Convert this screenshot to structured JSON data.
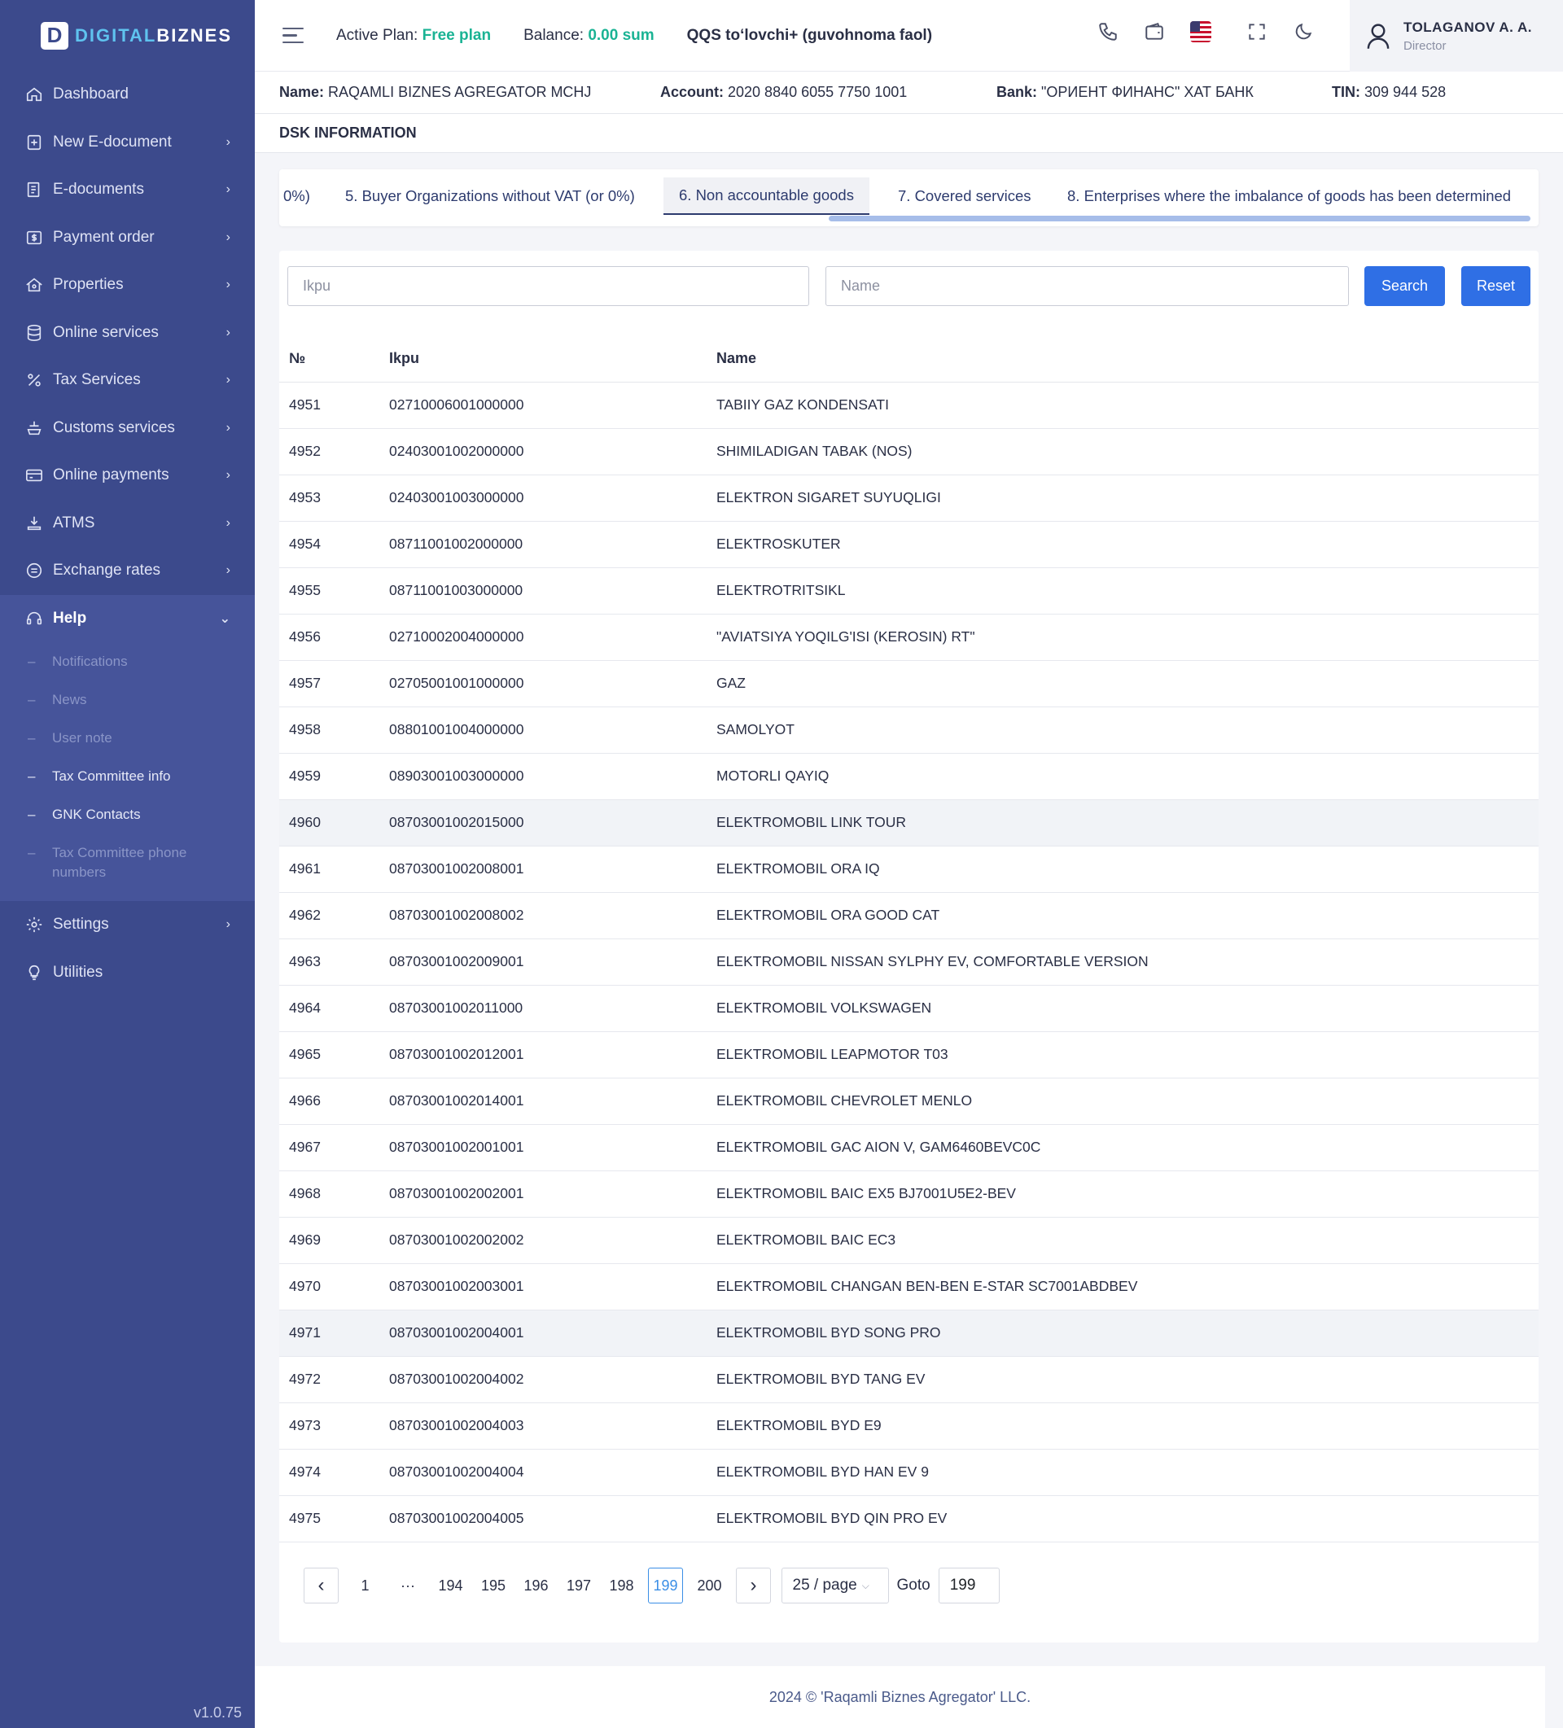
{
  "app": {
    "logo_letter": "D",
    "logo_part1": "DIGITAL",
    "logo_part2": "BIZNES",
    "version": "v1.0.75"
  },
  "sidebar": {
    "items": [
      {
        "label": "Dashboard",
        "icon": "home-icon"
      },
      {
        "label": "New E-document",
        "icon": "file-plus-icon"
      },
      {
        "label": "E-documents",
        "icon": "document-icon"
      },
      {
        "label": "Payment order",
        "icon": "dollar-icon"
      },
      {
        "label": "Properties",
        "icon": "house-icon"
      },
      {
        "label": "Online services",
        "icon": "database-icon"
      },
      {
        "label": "Tax Services",
        "icon": "percent-icon"
      },
      {
        "label": "Customs services",
        "icon": "customs-icon"
      },
      {
        "label": "Online payments",
        "icon": "card-icon"
      },
      {
        "label": "ATMS",
        "icon": "atm-icon"
      },
      {
        "label": "Exchange rates",
        "icon": "exchange-icon"
      },
      {
        "label": "Help",
        "icon": "headset-icon"
      },
      {
        "label": "Settings",
        "icon": "gear-icon"
      },
      {
        "label": "Utilities",
        "icon": "bulb-icon"
      }
    ],
    "help_sub": [
      {
        "label": "Notifications"
      },
      {
        "label": "News"
      },
      {
        "label": "User note"
      },
      {
        "label": "Tax Committee info"
      },
      {
        "label": "GNK Contacts"
      },
      {
        "label": "Tax Committee phone numbers"
      }
    ]
  },
  "topbar": {
    "plan_label": "Active Plan:",
    "plan_value": "Free plan",
    "balance_label": "Balance:",
    "balance_value": "0.00 sum",
    "qqs": "QQS toʻlovchi+ (guvohnoma faol)",
    "user_name": "TOLAGANOV A. A.",
    "user_role": "Director"
  },
  "company": {
    "name_label": "Name:",
    "name_value": "RAQAMLI BIZNES AGREGATOR MCHJ",
    "account_label": "Account:",
    "account_value": "2020 8840 6055 7750 1001",
    "bank_label": "Bank:",
    "bank_value": "\"ОРИЕНТ ФИНАНС\" ХАТ БАНК",
    "tin_label": "TIN:",
    "tin_value": "309 944 528"
  },
  "page": {
    "title": "DSK INFORMATION",
    "tabs": [
      {
        "label": "0%)"
      },
      {
        "label": "5. Buyer Organizations without VAT (or 0%)"
      },
      {
        "label": "6. Non accountable goods"
      },
      {
        "label": "7. Covered services"
      },
      {
        "label": "8. Enterprises where the imbalance of goods has been determined"
      }
    ]
  },
  "filters": {
    "ikpu_placeholder": "Ikpu",
    "name_placeholder": "Name",
    "search_label": "Search",
    "reset_label": "Reset"
  },
  "table": {
    "headers": [
      "№",
      "Ikpu",
      "Name"
    ],
    "rows": [
      {
        "num": "4951",
        "ikpu": "02710006001000000",
        "name": "TABIIY GAZ KONDENSATI"
      },
      {
        "num": "4952",
        "ikpu": "02403001002000000",
        "name": "SHIMILADIGAN TABAK (NOS)"
      },
      {
        "num": "4953",
        "ikpu": "02403001003000000",
        "name": "ELEKTRON SIGARET SUYUQLIGI"
      },
      {
        "num": "4954",
        "ikpu": "08711001002000000",
        "name": "ELEKTROSKUTER"
      },
      {
        "num": "4955",
        "ikpu": "08711001003000000",
        "name": "ELEKTROTRITSIKL"
      },
      {
        "num": "4956",
        "ikpu": "02710002004000000",
        "name": "\"AVIATSIYA YOQILG'ISI (KEROSIN) RT\""
      },
      {
        "num": "4957",
        "ikpu": "02705001001000000",
        "name": "GAZ"
      },
      {
        "num": "4958",
        "ikpu": "08801001004000000",
        "name": "SAMOLYOT"
      },
      {
        "num": "4959",
        "ikpu": "08903001003000000",
        "name": "MOTORLI QAYIQ"
      },
      {
        "num": "4960",
        "ikpu": "08703001002015000",
        "name": "ELEKTROMOBIL LINK TOUR"
      },
      {
        "num": "4961",
        "ikpu": "08703001002008001",
        "name": "ELEKTROMOBIL ORA IQ"
      },
      {
        "num": "4962",
        "ikpu": "08703001002008002",
        "name": "ELEKTROMOBIL ORA GOOD CAT"
      },
      {
        "num": "4963",
        "ikpu": "08703001002009001",
        "name": "ELEKTROMOBIL NISSAN SYLPHY EV, COMFORTABLE VERSION"
      },
      {
        "num": "4964",
        "ikpu": "08703001002011000",
        "name": "ELEKTROMOBIL VOLKSWAGEN"
      },
      {
        "num": "4965",
        "ikpu": "08703001002012001",
        "name": "ELEKTROMOBIL LEAPMOTOR T03"
      },
      {
        "num": "4966",
        "ikpu": "08703001002014001",
        "name": "ELEKTROMOBIL CHEVROLET MENLO"
      },
      {
        "num": "4967",
        "ikpu": "08703001002001001",
        "name": "ELEKTROMOBIL GAC AION V, GAM6460BEVC0C"
      },
      {
        "num": "4968",
        "ikpu": "08703001002002001",
        "name": "ELEKTROMOBIL BAIC EX5 BJ7001U5E2-BEV"
      },
      {
        "num": "4969",
        "ikpu": "08703001002002002",
        "name": "ELEKTROMOBIL BAIC EC3"
      },
      {
        "num": "4970",
        "ikpu": "08703001002003001",
        "name": "ELEKTROMOBIL CHANGAN BEN-BEN E-STAR SC7001ABDBEV"
      },
      {
        "num": "4971",
        "ikpu": "08703001002004001",
        "name": "ELEKTROMOBIL BYD SONG PRO"
      },
      {
        "num": "4972",
        "ikpu": "08703001002004002",
        "name": "ELEKTROMOBIL BYD TANG EV"
      },
      {
        "num": "4973",
        "ikpu": "08703001002004003",
        "name": "ELEKTROMOBIL BYD E9"
      },
      {
        "num": "4974",
        "ikpu": "08703001002004004",
        "name": "ELEKTROMOBIL BYD HAN EV 9"
      },
      {
        "num": "4975",
        "ikpu": "08703001002004005",
        "name": "ELEKTROMOBIL BYD QIN PRO EV"
      }
    ]
  },
  "pagination": {
    "pages": [
      "1",
      "···",
      "194",
      "195",
      "196",
      "197",
      "198",
      "199",
      "200"
    ],
    "current": "199",
    "page_size": "25 / page",
    "goto_label": "Goto",
    "goto_value": "199"
  },
  "footer": {
    "text": "2024 © 'Raqamli Biznes Agregator' LLC."
  }
}
